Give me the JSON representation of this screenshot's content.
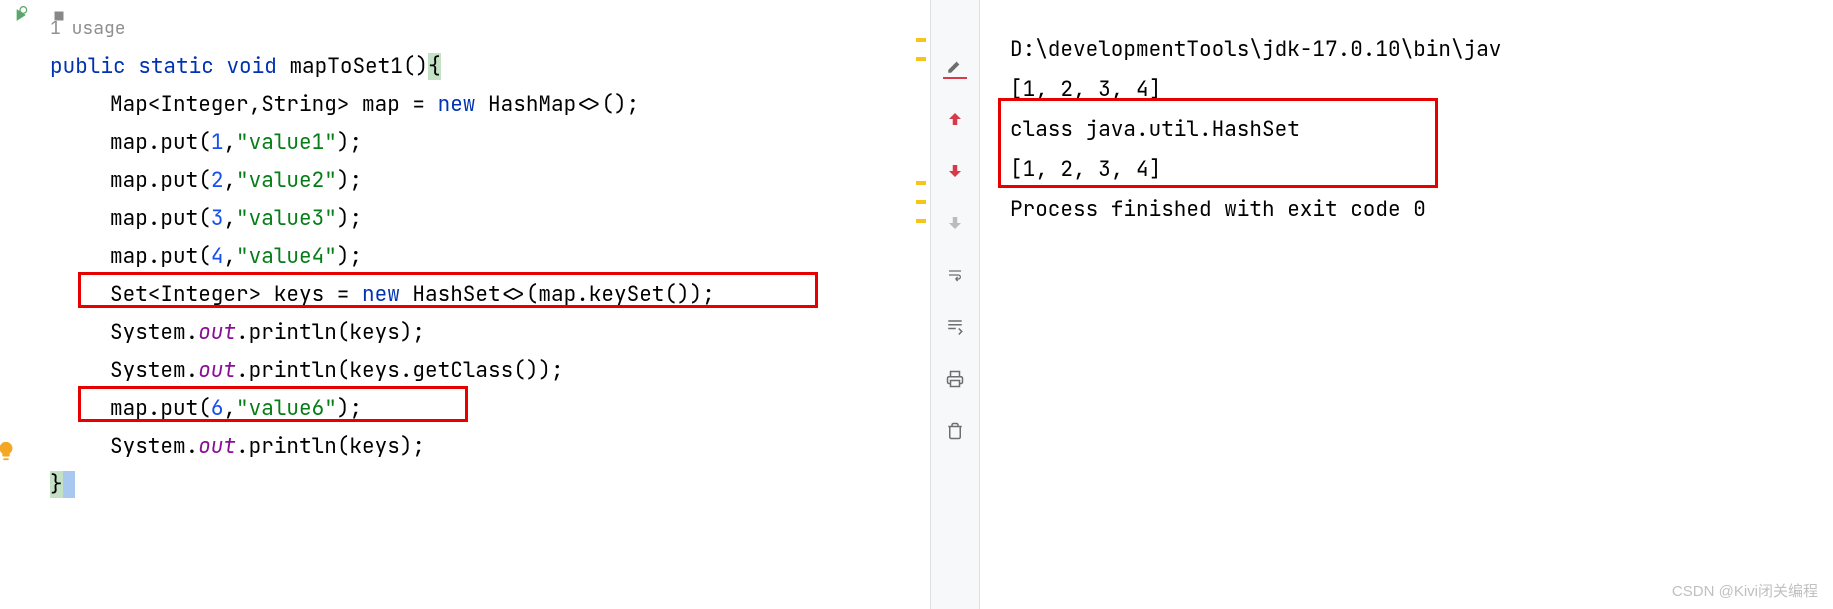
{
  "editor": {
    "usage_hint": "1 usage",
    "lines": [
      {
        "type": "signature",
        "kw1": "public",
        "kw2": "static",
        "kw3": "void",
        "method": "mapToSet1",
        "params": "()",
        "brace": "{"
      },
      {
        "type": "decl",
        "text1": "Map<Integer,String> map = ",
        "kw": "new",
        "text2": " HashMap<>();"
      },
      {
        "type": "put",
        "prefix": "map.put(",
        "num": "1",
        "comma": ",",
        "str": "\"value1\"",
        "suffix": ");"
      },
      {
        "type": "put",
        "prefix": "map.put(",
        "num": "2",
        "comma": ",",
        "str": "\"value2\"",
        "suffix": ");"
      },
      {
        "type": "put",
        "prefix": "map.put(",
        "num": "3",
        "comma": ",",
        "str": "\"value3\"",
        "suffix": ");"
      },
      {
        "type": "put",
        "prefix": "map.put(",
        "num": "4",
        "comma": ",",
        "str": "\"value4\"",
        "suffix": ");"
      },
      {
        "type": "set",
        "text1": "Set<Integer> keys = ",
        "kw": "new",
        "text2": " HashSet<>(map.keySet());"
      },
      {
        "type": "println",
        "prefix": "System.",
        "field": "out",
        "call": ".println(keys);"
      },
      {
        "type": "println",
        "prefix": "System.",
        "field": "out",
        "call": ".println(keys.getClass());"
      },
      {
        "type": "put",
        "prefix": "map.put(",
        "num": "6",
        "comma": ",",
        "str": "\"value6\"",
        "suffix": ");"
      },
      {
        "type": "println",
        "prefix": "System.",
        "field": "out",
        "call": ".println(keys);"
      },
      {
        "type": "close",
        "brace": "}"
      }
    ]
  },
  "output": {
    "lines": [
      "D:\\developmentTools\\jdk-17.0.10\\bin\\jav",
      "[1, 2, 3, 4]",
      "class java.util.HashSet",
      "[1, 2, 3, 4]",
      "",
      "Process finished with exit code 0"
    ]
  },
  "watermark": "CSDN @Kivi闭关编程"
}
